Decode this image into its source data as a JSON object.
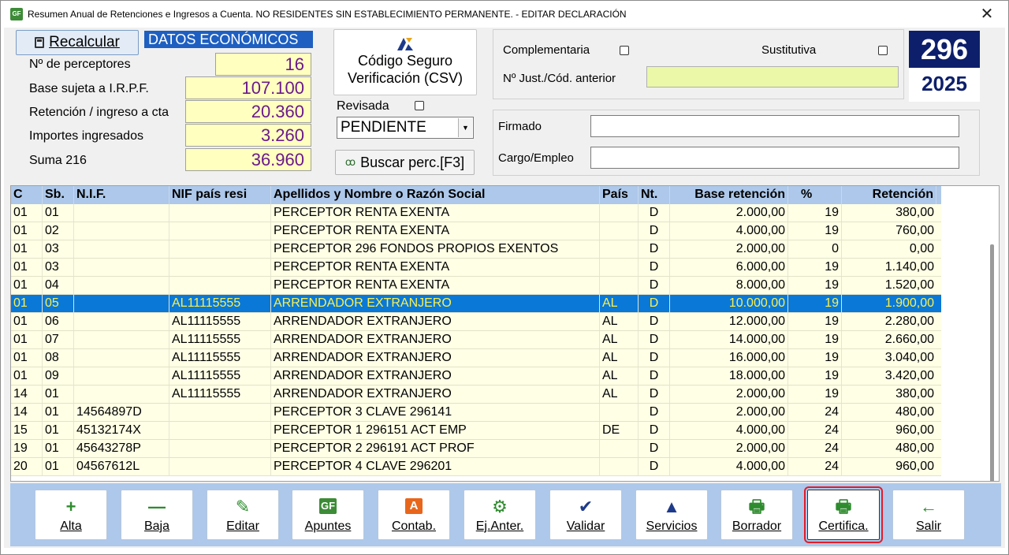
{
  "window": {
    "title": "Resumen Anual de Retenciones e Ingresos a Cuenta. NO RESIDENTES SIN ESTABLECIMIENTO PERMANENTE. - EDITAR DECLARACIÓN",
    "app_icon": "GF",
    "close_glyph": "✕"
  },
  "datos": {
    "recalcular": "Recalcular",
    "title": "DATOS ECONÓMICOS",
    "fields": [
      {
        "label": "Nº  de perceptores",
        "value": "16"
      },
      {
        "label": "Base sujeta a I.R.P.F.",
        "value": "107.100"
      },
      {
        "label": "Retención / ingreso a cta",
        "value": "20.360"
      },
      {
        "label": "Importes ingresados",
        "value": "3.260"
      },
      {
        "label": "Suma 216",
        "value": "36.960"
      }
    ]
  },
  "csv": {
    "line1": "Código Seguro",
    "line2": "Verificación (CSV)"
  },
  "revisada": {
    "label": "Revisada",
    "checked": false
  },
  "estado": {
    "value": "PENDIENTE"
  },
  "buscar": {
    "label": "Buscar perc.[F3]"
  },
  "complementaria": {
    "label": "Complementaria",
    "sustitutiva": "Sustitutiva",
    "just_label": "Nº Just./Cód. anterior",
    "just_value": ""
  },
  "model": {
    "number": "296",
    "year": "2025"
  },
  "firma": {
    "firmado": "Firmado",
    "firmado_value": "",
    "cargo": "Cargo/Empleo",
    "cargo_value": ""
  },
  "grid": {
    "headers": [
      "C",
      "Sb.",
      "N.I.F.",
      "NIF país resi",
      "Apellidos y Nombre o Razón Social",
      "País",
      "Nt.",
      "Base retención",
      "%",
      "Retención"
    ],
    "rows": [
      [
        "01",
        "01",
        "",
        "",
        "PERCEPTOR RENTA EXENTA",
        "",
        "D",
        "2.000,00",
        "19",
        "380,00"
      ],
      [
        "01",
        "02",
        "",
        "",
        "PERCEPTOR RENTA EXENTA",
        "",
        "D",
        "4.000,00",
        "19",
        "760,00"
      ],
      [
        "01",
        "03",
        "",
        "",
        "PERCEPTOR 296 FONDOS PROPIOS EXENTOS",
        "",
        "D",
        "2.000,00",
        "0",
        "0,00"
      ],
      [
        "01",
        "03",
        "",
        "",
        "PERCEPTOR RENTA EXENTA",
        "",
        "D",
        "6.000,00",
        "19",
        "1.140,00"
      ],
      [
        "01",
        "04",
        "",
        "",
        "PERCEPTOR RENTA EXENTA",
        "",
        "D",
        "8.000,00",
        "19",
        "1.520,00"
      ],
      [
        "01",
        "05",
        "",
        "AL11115555",
        "ARRENDADOR EXTRANJERO",
        "AL",
        "D",
        "10.000,00",
        "19",
        "1.900,00"
      ],
      [
        "01",
        "06",
        "",
        "AL11115555",
        "ARRENDADOR EXTRANJERO",
        "AL",
        "D",
        "12.000,00",
        "19",
        "2.280,00"
      ],
      [
        "01",
        "07",
        "",
        "AL11115555",
        "ARRENDADOR EXTRANJERO",
        "AL",
        "D",
        "14.000,00",
        "19",
        "2.660,00"
      ],
      [
        "01",
        "08",
        "",
        "AL11115555",
        "ARRENDADOR EXTRANJERO",
        "AL",
        "D",
        "16.000,00",
        "19",
        "3.040,00"
      ],
      [
        "01",
        "09",
        "",
        "AL11115555",
        "ARRENDADOR EXTRANJERO",
        "AL",
        "D",
        "18.000,00",
        "19",
        "3.420,00"
      ],
      [
        "14",
        "01",
        "",
        "AL11115555",
        "ARRENDADOR EXTRANJERO",
        "AL",
        "D",
        "2.000,00",
        "19",
        "380,00"
      ],
      [
        "14",
        "01",
        "14564897D",
        "",
        "PERCEPTOR 3 CLAVE 296141",
        "",
        "D",
        "2.000,00",
        "24",
        "480,00"
      ],
      [
        "15",
        "01",
        "45132174X",
        "",
        "PERCEPTOR 1 296151 ACT EMP",
        "DE",
        "D",
        "4.000,00",
        "24",
        "960,00"
      ],
      [
        "19",
        "01",
        "45643278P",
        "",
        "PERCEPTOR 2 296191 ACT PROF",
        "",
        "D",
        "2.000,00",
        "24",
        "480,00"
      ],
      [
        "20",
        "01",
        "04567612L",
        "",
        "PERCEPTOR 4 CLAVE 296201",
        "",
        "D",
        "4.000,00",
        "24",
        "960,00"
      ]
    ],
    "selected_index": 5
  },
  "toolbar": [
    {
      "label": "Alta",
      "icon": "plus-icon",
      "glyph": "+",
      "color": "#2e8b2e"
    },
    {
      "label": "Baja",
      "icon": "minus-icon",
      "glyph": "—",
      "color": "#2e8b2e"
    },
    {
      "label": "Editar",
      "icon": "edit-icon",
      "glyph": "✎",
      "color": "#2e8b2e"
    },
    {
      "label": "Apuntes",
      "icon": "gf-logo-icon",
      "glyph": "GF",
      "color": "#3d8b37"
    },
    {
      "label": "Contab.",
      "icon": "a3-logo-icon",
      "glyph": "A",
      "color": "#e8661c"
    },
    {
      "label": "Ej.Anter.",
      "icon": "gears-icon",
      "glyph": "⚙",
      "color": "#2e8b2e"
    },
    {
      "label": "Validar",
      "icon": "aeat-check-icon",
      "glyph": "✔",
      "color": "#1e3a8a"
    },
    {
      "label": "Servicios",
      "icon": "aeat-logo-icon",
      "glyph": "▲",
      "color": "#1e3a8a"
    },
    {
      "label": "Borrador",
      "icon": "printer-icon",
      "glyph": "🖶",
      "color": "#2e8b2e"
    },
    {
      "label": "Certifica.",
      "icon": "printer-icon",
      "glyph": "🖶",
      "color": "#2e8b2e"
    },
    {
      "label": "Salir",
      "icon": "arrow-left-icon",
      "glyph": "←",
      "color": "#2e8b2e"
    }
  ],
  "active_toolbar_index": 9
}
